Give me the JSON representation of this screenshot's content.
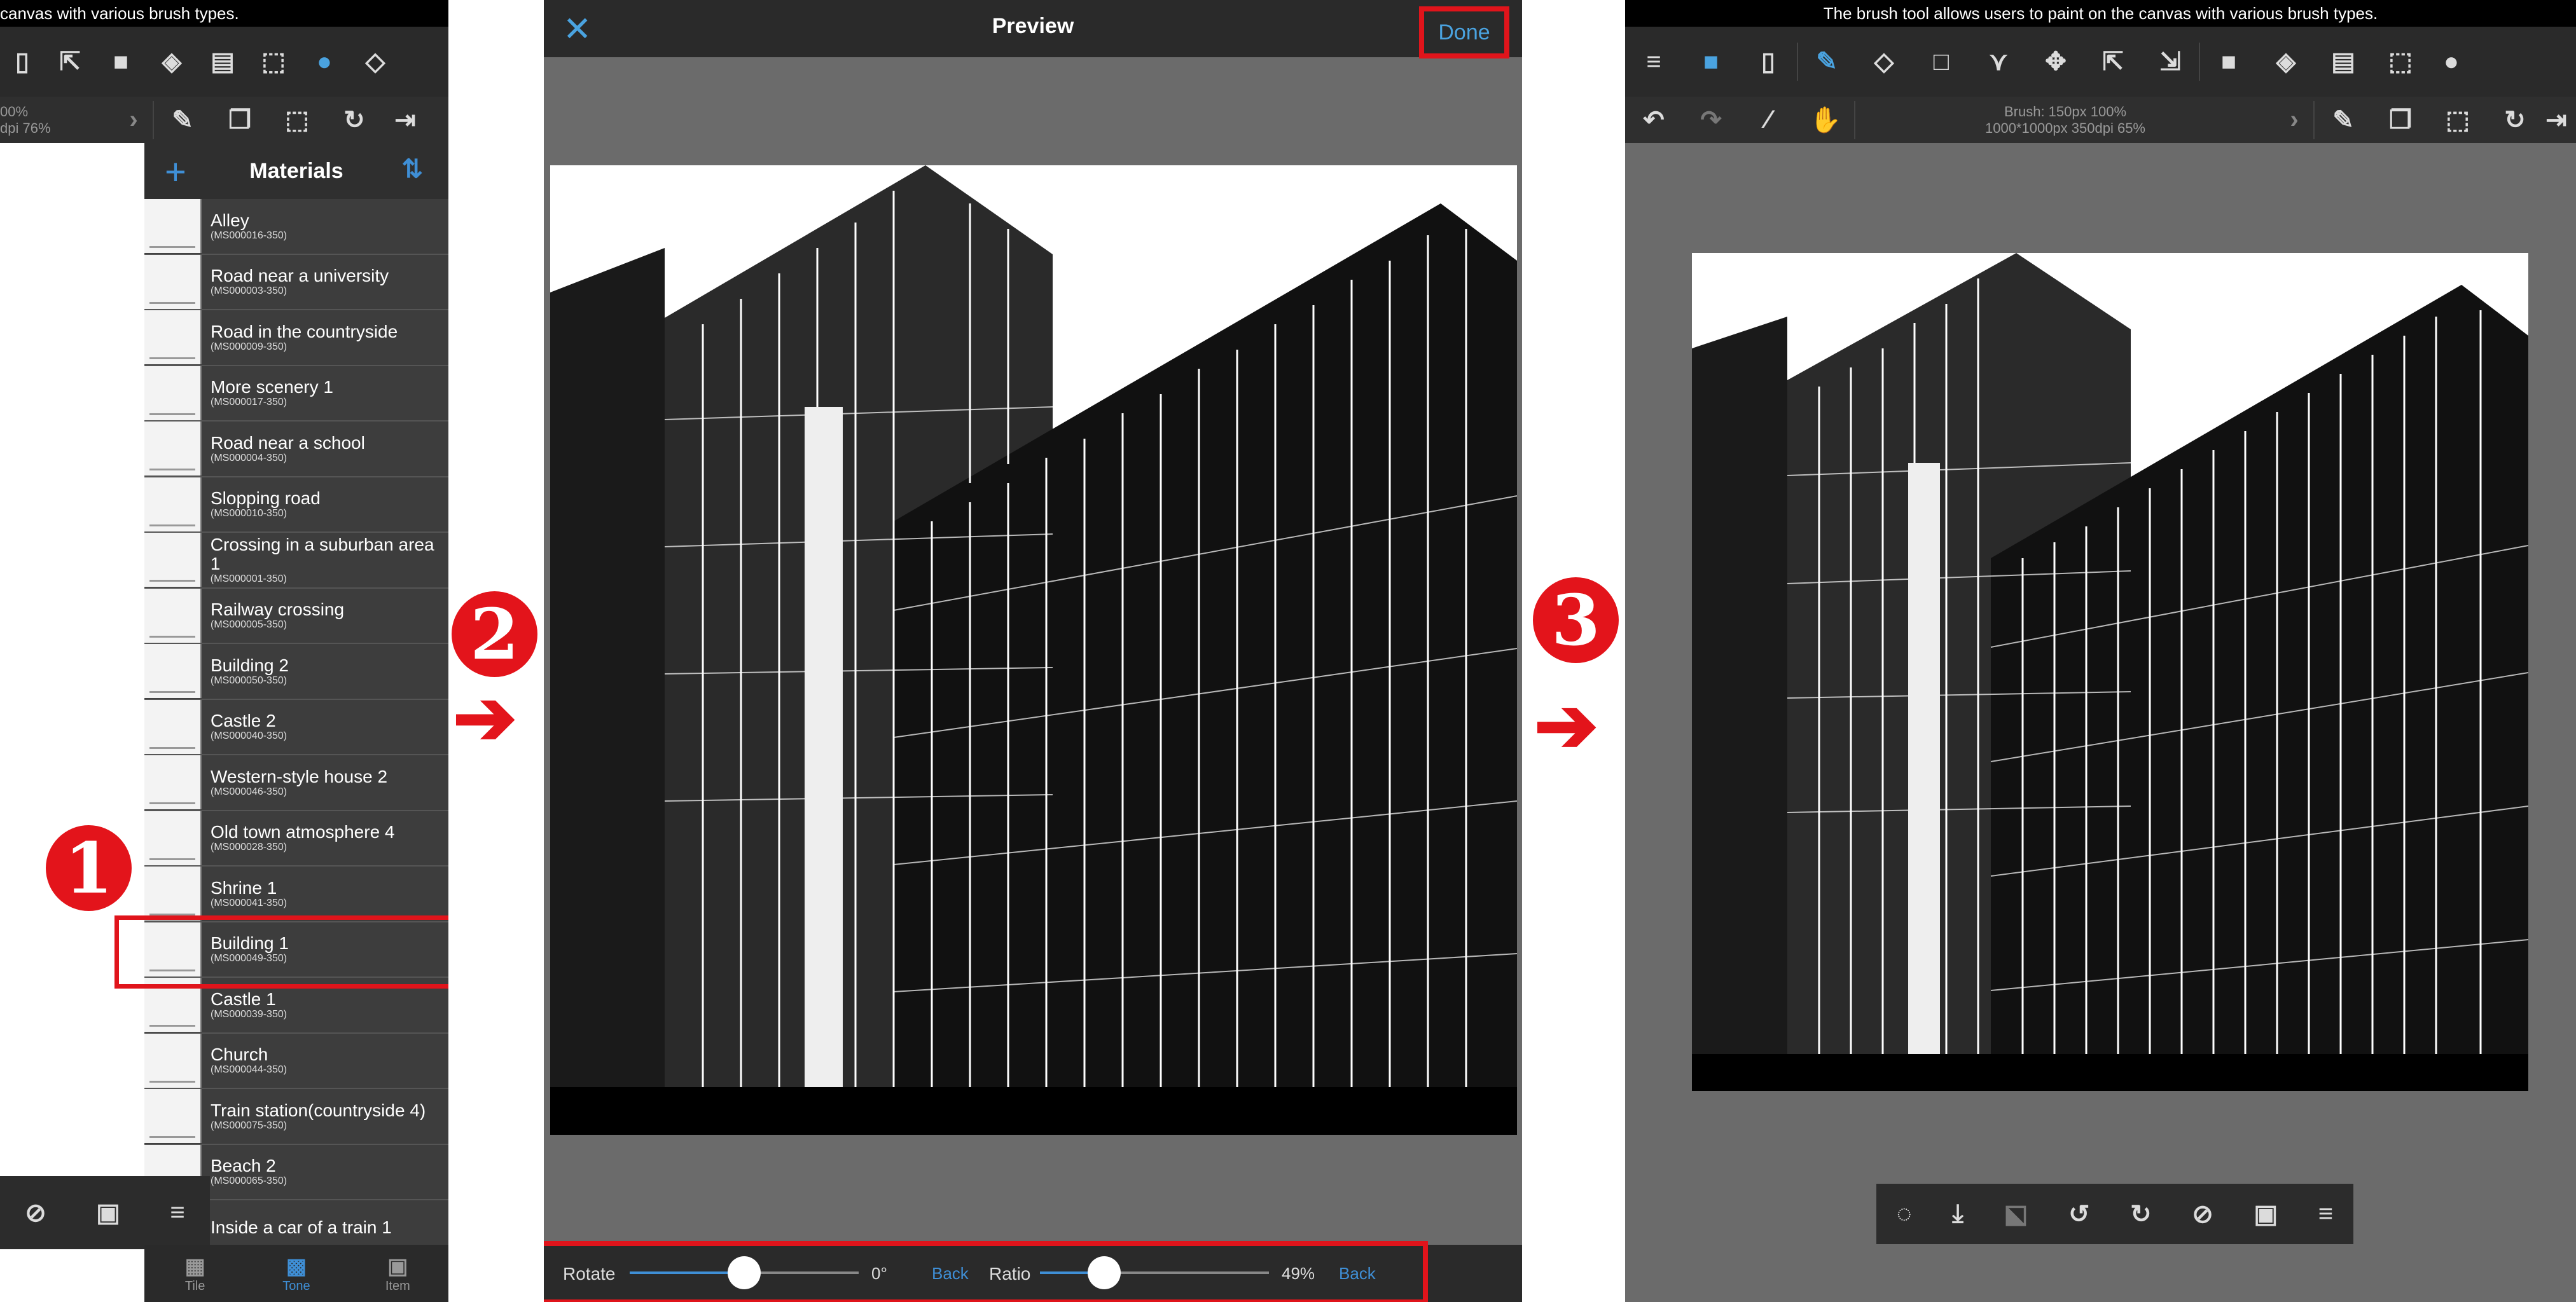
{
  "panel1": {
    "topbar_text": "canvas with various brush types.",
    "info_line1": "00%",
    "info_line2": "dpi 76%",
    "materials": {
      "title": "Materials",
      "items": [
        {
          "name": "Alley",
          "code": "(MS000016-350)"
        },
        {
          "name": "Road near a university",
          "code": "(MS000003-350)"
        },
        {
          "name": "Road in the countryside",
          "code": "(MS000009-350)"
        },
        {
          "name": "More scenery 1",
          "code": "(MS000017-350)"
        },
        {
          "name": "Road near a school",
          "code": "(MS000004-350)"
        },
        {
          "name": "Slopping road",
          "code": "(MS000010-350)"
        },
        {
          "name": "Crossing in a suburban area 1",
          "code": "(MS000001-350)"
        },
        {
          "name": "Railway crossing",
          "code": "(MS000005-350)"
        },
        {
          "name": "Building 2",
          "code": "(MS000050-350)"
        },
        {
          "name": "Castle 2",
          "code": "(MS000040-350)"
        },
        {
          "name": "Western-style house 2",
          "code": "(MS000046-350)"
        },
        {
          "name": "Old town atmosphere 4",
          "code": "(MS000028-350)"
        },
        {
          "name": "Shrine 1",
          "code": "(MS000041-350)"
        },
        {
          "name": "Building 1",
          "code": "(MS000049-350)"
        },
        {
          "name": "Castle 1",
          "code": "(MS000039-350)"
        },
        {
          "name": "Church",
          "code": "(MS000044-350)"
        },
        {
          "name": "Train station(countryside 4)",
          "code": "(MS000075-350)"
        },
        {
          "name": "Beach 2",
          "code": "(MS000065-350)"
        },
        {
          "name": "Inside a car of a train 1",
          "code": ""
        }
      ]
    },
    "tabs": [
      {
        "label": "Tile",
        "icon": "tile-icon"
      },
      {
        "label": "Tone",
        "icon": "tone-icon"
      },
      {
        "label": "Item",
        "icon": "item-icon"
      }
    ],
    "step_badge": "1"
  },
  "panel2": {
    "title": "Preview",
    "done_label": "Done",
    "rotate_label": "Rotate",
    "rotate_value": "0°",
    "rotate_fraction": 0.5,
    "rotate_back": "Back",
    "ratio_label": "Ratio",
    "ratio_value": "49%",
    "ratio_fraction": 0.28,
    "ratio_back": "Back",
    "step_badge": "2"
  },
  "panel3": {
    "topbar_text": "The brush tool allows users to paint on the canvas with various brush types.",
    "brush_line1": "Brush: 150px 100%",
    "brush_line2": "1000*1000px 350dpi 65%",
    "step_badge": "3"
  },
  "colors": {
    "accent": "#e3141b",
    "blue": "#3f8fd6"
  }
}
